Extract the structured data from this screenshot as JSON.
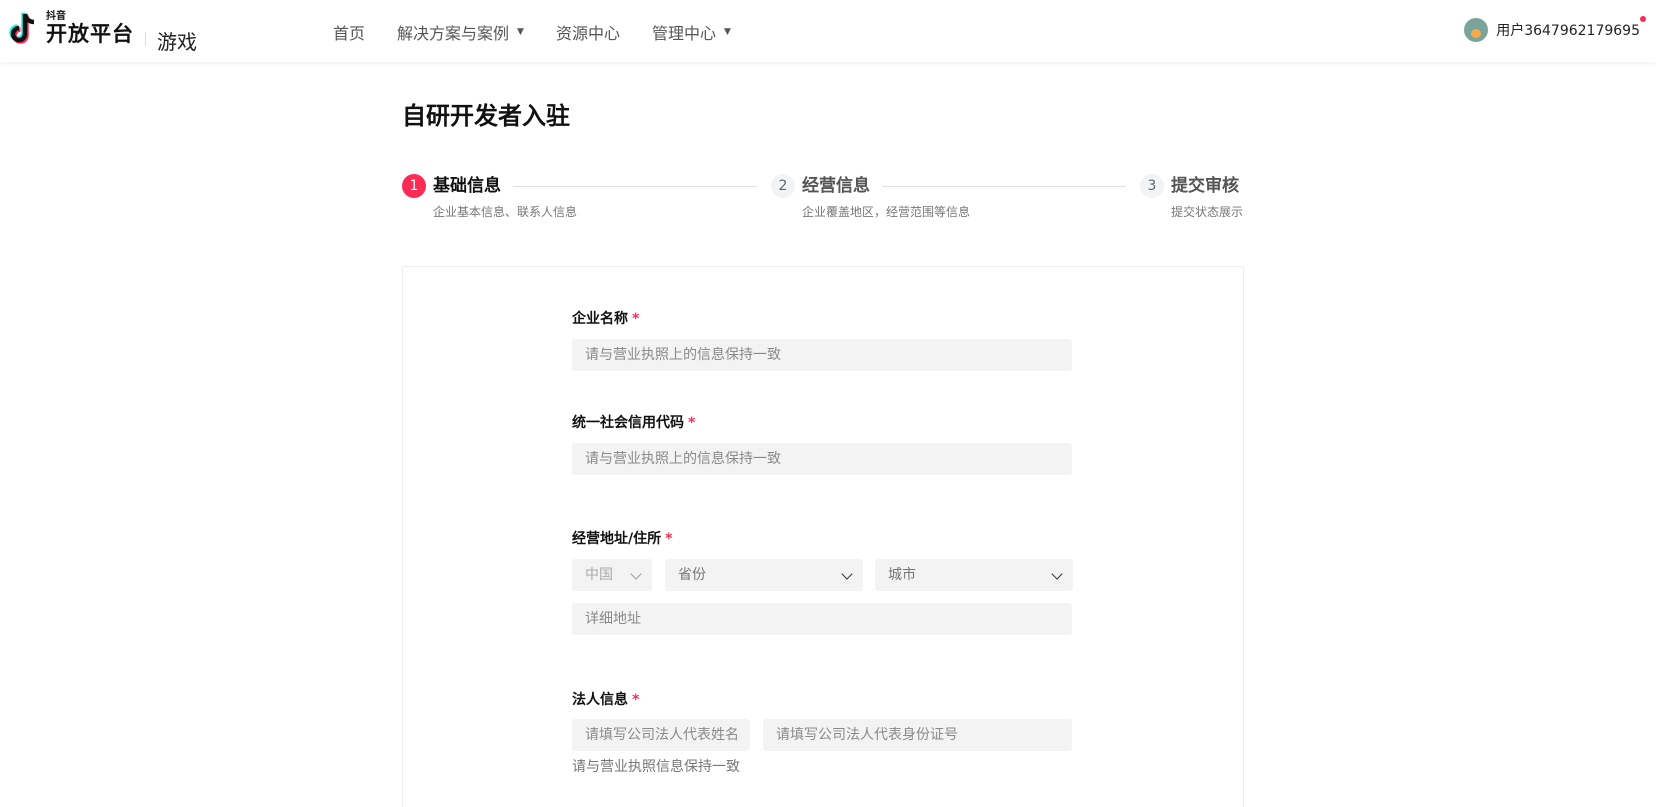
{
  "header": {
    "logo_small": "抖音",
    "logo_big": "开放平台",
    "logo_product": "游戏",
    "nav": [
      {
        "label": "首页",
        "has_caret": false
      },
      {
        "label": "解决方案与案例",
        "has_caret": true
      },
      {
        "label": "资源中心",
        "has_caret": false
      },
      {
        "label": "管理中心",
        "has_caret": true
      }
    ],
    "user_name": "用户3647962179695"
  },
  "page": {
    "title": "自研开发者入驻"
  },
  "steps": [
    {
      "num": "1",
      "title": "基础信息",
      "desc": "企业基本信息、联系人信息",
      "active": true
    },
    {
      "num": "2",
      "title": "经营信息",
      "desc": "企业覆盖地区，经营范围等信息",
      "active": false
    },
    {
      "num": "3",
      "title": "提交审核",
      "desc": "提交状态展示",
      "active": false
    }
  ],
  "form": {
    "company_name": {
      "label": "企业名称",
      "required_mark": "*",
      "placeholder": "请与营业执照上的信息保持一致"
    },
    "credit_code": {
      "label": "统一社会信用代码",
      "required_mark": "*",
      "placeholder": "请与营业执照上的信息保持一致"
    },
    "address": {
      "label": "经营地址/住所",
      "required_mark": "*",
      "country": "中国",
      "province": "省份",
      "city": "城市",
      "detail_placeholder": "详细地址"
    },
    "legal": {
      "label": "法人信息",
      "required_mark": "*",
      "name_placeholder": "请填写公司法人代表姓名",
      "id_placeholder": "请填写公司法人代表身份证号",
      "hint": "请与营业执照信息保持一致"
    }
  },
  "colors": {
    "accent": "#fe2c55",
    "input_bg": "#f3f3f3"
  }
}
